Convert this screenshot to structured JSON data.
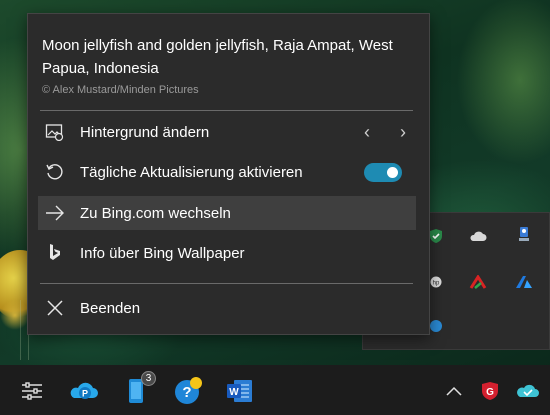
{
  "menu": {
    "title": "Moon jellyfish and golden jellyfish, Raja Ampat, West Papua, Indonesia",
    "credit": "© Alex Mustard/Minden Pictures",
    "items": [
      {
        "label": "Hintergrund ändern",
        "icon": "image-icon"
      },
      {
        "label": "Tägliche Aktualisierung aktivieren",
        "icon": "refresh-icon",
        "toggle_on": true
      },
      {
        "label": "Zu Bing.com wechseln",
        "icon": "arrow-right-icon"
      },
      {
        "label": "Info über Bing Wallpaper",
        "icon": "bing-icon"
      },
      {
        "label": "Beenden",
        "icon": "close-icon"
      }
    ],
    "prev_arrow": "‹",
    "next_arrow": "›"
  },
  "taskbar": {
    "items": [
      {
        "name": "settings-sliders-icon"
      },
      {
        "name": "onedrive-personal-icon",
        "glyph": "P"
      },
      {
        "name": "phone-link-icon",
        "badge": "3"
      },
      {
        "name": "help-icon",
        "glyph": "?"
      },
      {
        "name": "word-icon",
        "glyph": "W"
      }
    ],
    "tray": [
      "chevron-up-icon",
      "shield-g-icon",
      "onedrive-sync-icon"
    ]
  },
  "colors": {
    "menu_bg": "#2b2b2b",
    "toggle_on": "#1e8bb3",
    "hover_bg": "#3f3f3f"
  }
}
